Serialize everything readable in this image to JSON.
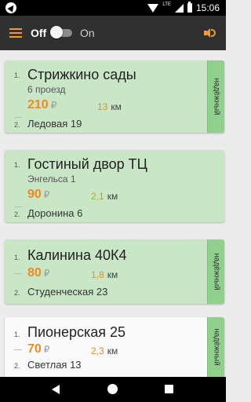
{
  "status": {
    "time": "15:06",
    "network": "LTE"
  },
  "toolbar": {
    "off_label": "Off",
    "on_label": "On",
    "toggle_state": "off"
  },
  "colors": {
    "accent": "#f08a1c",
    "card_green": "#c9e6c7",
    "badge_green": "#8fd08c",
    "toolbar": "#303030"
  },
  "orders": [
    {
      "from": "Стрижкино сады",
      "sub": "6 проезд",
      "price": "210",
      "currency": "₽",
      "distance": "13",
      "unit": "км",
      "to": "Ледовая 19",
      "badge": "надёжный",
      "num_from": "1.",
      "num_to": "2."
    },
    {
      "from": "Гостиный двор ТЦ",
      "sub": "Энгельса 1",
      "price": "90",
      "currency": "₽",
      "distance": "2,1",
      "unit": "км",
      "to": "Доронина 6",
      "badge": "",
      "num_from": "1.",
      "num_to": "2."
    },
    {
      "from": "Калинина 40К4",
      "sub": "",
      "price": "80",
      "currency": "₽",
      "distance": "1,8",
      "unit": "км",
      "to": "Студенческая 23",
      "badge": "надёжный",
      "num_from": "1.",
      "num_to": "2."
    },
    {
      "from": "Пионерская 25",
      "sub": "",
      "price": "70",
      "currency": "₽",
      "distance": "2,3",
      "unit": "км",
      "to": "Светлая 13",
      "badge": "надёжный",
      "num_from": "1.",
      "num_to": "2."
    }
  ]
}
